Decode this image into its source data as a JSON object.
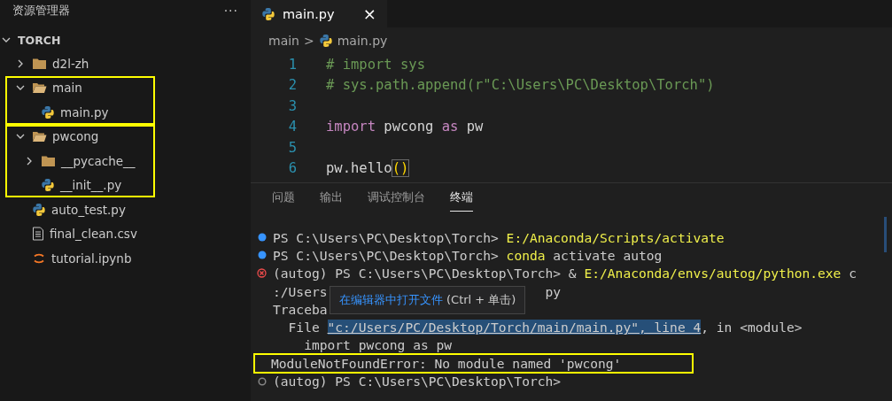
{
  "sidebar": {
    "title": "资源管理器",
    "more": "···",
    "root": {
      "label": "TORCH",
      "expanded": true,
      "children": [
        {
          "label": "d2l-zh",
          "kind": "folder",
          "expanded": false,
          "highlighted": false
        },
        {
          "label": "main",
          "kind": "folder",
          "expanded": true,
          "highlighted": true,
          "children": [
            {
              "label": "main.py",
              "kind": "python"
            }
          ]
        },
        {
          "label": "pwcong",
          "kind": "folder",
          "expanded": true,
          "highlighted": true,
          "children": [
            {
              "label": "__pycache__",
              "kind": "folder",
              "expanded": false
            },
            {
              "label": "__init__.py",
              "kind": "python"
            }
          ]
        },
        {
          "label": "auto_test.py",
          "kind": "python"
        },
        {
          "label": "final_clean.csv",
          "kind": "text"
        },
        {
          "label": "tutorial.ipynb",
          "kind": "notebook"
        }
      ]
    }
  },
  "tabs": [
    {
      "label": "main.py",
      "selected": true,
      "close": "×"
    }
  ],
  "breadcrumb": {
    "folder": "main",
    "separator": ">",
    "file": "main.py"
  },
  "code_lines": [
    {
      "number": "1",
      "tokens": [
        {
          "text": "# import sys",
          "kind": "comment"
        }
      ]
    },
    {
      "number": "2",
      "tokens": [
        {
          "text": "# sys.path.append(r\"C:\\Users\\PC\\Desktop\\Torch\")",
          "kind": "comment"
        }
      ]
    },
    {
      "number": "3"
    },
    {
      "number": "4",
      "tokens": [
        {
          "text": "import",
          "kind": "keyword"
        },
        {
          "text": " pwcong ",
          "kind": "module"
        },
        {
          "text": "as",
          "kind": "keyword"
        },
        {
          "text": " pw",
          "kind": "module"
        }
      ]
    },
    {
      "number": "5"
    },
    {
      "number": "6",
      "tokens": [
        {
          "text": "pw.hello",
          "kind": "plain"
        },
        {
          "text": "()",
          "kind": "bracket"
        }
      ]
    }
  ],
  "panel_tabs": [
    {
      "label": "问题",
      "selected": false
    },
    {
      "label": "输出",
      "selected": false
    },
    {
      "label": "调试控制台",
      "selected": false
    },
    {
      "label": "终端",
      "selected": true
    }
  ],
  "terminal": {
    "lines": [
      {
        "kind": "success",
        "highlighted": false,
        "parts": [
          {
            "text": "PS C:\\Users\\PC\\Desktop\\Torch> ",
            "kind": "plain"
          },
          {
            "text": "E:/Anaconda/Scripts/activate",
            "kind": "command"
          }
        ]
      },
      {
        "kind": "success",
        "highlighted": false,
        "parts": [
          {
            "text": "PS C:\\Users\\PC\\Desktop\\Torch> ",
            "kind": "plain"
          },
          {
            "text": "conda",
            "kind": "command"
          },
          {
            "text": " activate autog",
            "kind": "plain"
          }
        ]
      },
      {
        "kind": "error",
        "highlighted": false,
        "parts": [
          {
            "text": "(autog) PS C:\\Users\\PC\\Desktop\\Torch> & ",
            "kind": "plain"
          },
          {
            "text": "E:/Anaconda/envs/autog/python.exe",
            "kind": "command"
          },
          {
            "text": " c",
            "kind": "plain"
          }
        ]
      },
      {
        "kind": "output",
        "highlighted": false,
        "parts": [
          {
            "text": ":/Users",
            "kind": "plain"
          },
          {
            "text": "py",
            "kind": "after_tooltip"
          }
        ]
      },
      {
        "kind": "output",
        "highlighted": false,
        "parts": [
          {
            "text": "Traceba",
            "kind": "plain"
          }
        ]
      },
      {
        "kind": "output",
        "highlighted": false,
        "parts": [
          {
            "text": "  File ",
            "kind": "plain"
          },
          {
            "text": "\"c:/Users/PC/Desktop/Torch/main/main.py\", line 4",
            "kind": "link"
          },
          {
            "text": ", in <module>",
            "kind": "plain"
          }
        ]
      },
      {
        "kind": "output",
        "highlighted": false,
        "parts": [
          {
            "text": "    import pwcong as pw",
            "kind": "plain"
          }
        ]
      },
      {
        "kind": "output",
        "highlighted": true,
        "parts": [
          {
            "text": "ModuleNotFoundError: No module named 'pwcong'",
            "kind": "plain"
          }
        ]
      },
      {
        "kind": "idle",
        "highlighted": false,
        "parts": [
          {
            "text": "(autog) PS C:\\Users\\PC\\Desktop\\Torch>",
            "kind": "plain"
          }
        ]
      }
    ],
    "tooltip": {
      "action": "在编辑器中打开文件",
      "shortcut": "(Ctrl + 单击)"
    }
  }
}
